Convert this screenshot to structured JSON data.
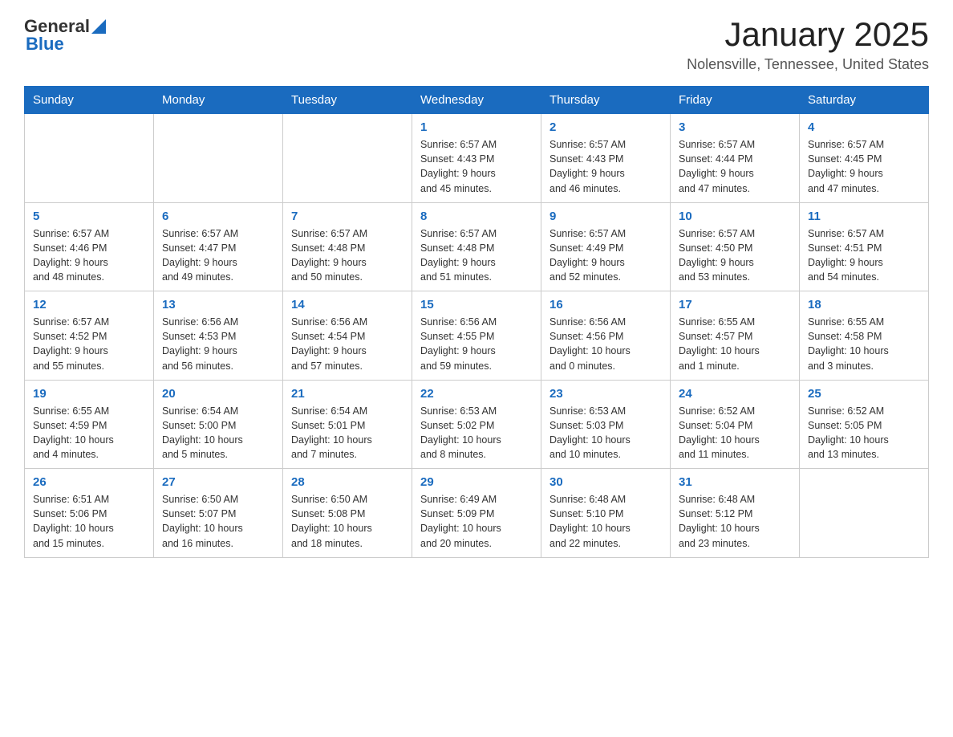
{
  "header": {
    "logo_general": "General",
    "logo_blue": "Blue",
    "month_title": "January 2025",
    "location": "Nolensville, Tennessee, United States"
  },
  "weekdays": [
    "Sunday",
    "Monday",
    "Tuesday",
    "Wednesday",
    "Thursday",
    "Friday",
    "Saturday"
  ],
  "weeks": [
    [
      {
        "day": "",
        "info": ""
      },
      {
        "day": "",
        "info": ""
      },
      {
        "day": "",
        "info": ""
      },
      {
        "day": "1",
        "info": "Sunrise: 6:57 AM\nSunset: 4:43 PM\nDaylight: 9 hours\nand 45 minutes."
      },
      {
        "day": "2",
        "info": "Sunrise: 6:57 AM\nSunset: 4:43 PM\nDaylight: 9 hours\nand 46 minutes."
      },
      {
        "day": "3",
        "info": "Sunrise: 6:57 AM\nSunset: 4:44 PM\nDaylight: 9 hours\nand 47 minutes."
      },
      {
        "day": "4",
        "info": "Sunrise: 6:57 AM\nSunset: 4:45 PM\nDaylight: 9 hours\nand 47 minutes."
      }
    ],
    [
      {
        "day": "5",
        "info": "Sunrise: 6:57 AM\nSunset: 4:46 PM\nDaylight: 9 hours\nand 48 minutes."
      },
      {
        "day": "6",
        "info": "Sunrise: 6:57 AM\nSunset: 4:47 PM\nDaylight: 9 hours\nand 49 minutes."
      },
      {
        "day": "7",
        "info": "Sunrise: 6:57 AM\nSunset: 4:48 PM\nDaylight: 9 hours\nand 50 minutes."
      },
      {
        "day": "8",
        "info": "Sunrise: 6:57 AM\nSunset: 4:48 PM\nDaylight: 9 hours\nand 51 minutes."
      },
      {
        "day": "9",
        "info": "Sunrise: 6:57 AM\nSunset: 4:49 PM\nDaylight: 9 hours\nand 52 minutes."
      },
      {
        "day": "10",
        "info": "Sunrise: 6:57 AM\nSunset: 4:50 PM\nDaylight: 9 hours\nand 53 minutes."
      },
      {
        "day": "11",
        "info": "Sunrise: 6:57 AM\nSunset: 4:51 PM\nDaylight: 9 hours\nand 54 minutes."
      }
    ],
    [
      {
        "day": "12",
        "info": "Sunrise: 6:57 AM\nSunset: 4:52 PM\nDaylight: 9 hours\nand 55 minutes."
      },
      {
        "day": "13",
        "info": "Sunrise: 6:56 AM\nSunset: 4:53 PM\nDaylight: 9 hours\nand 56 minutes."
      },
      {
        "day": "14",
        "info": "Sunrise: 6:56 AM\nSunset: 4:54 PM\nDaylight: 9 hours\nand 57 minutes."
      },
      {
        "day": "15",
        "info": "Sunrise: 6:56 AM\nSunset: 4:55 PM\nDaylight: 9 hours\nand 59 minutes."
      },
      {
        "day": "16",
        "info": "Sunrise: 6:56 AM\nSunset: 4:56 PM\nDaylight: 10 hours\nand 0 minutes."
      },
      {
        "day": "17",
        "info": "Sunrise: 6:55 AM\nSunset: 4:57 PM\nDaylight: 10 hours\nand 1 minute."
      },
      {
        "day": "18",
        "info": "Sunrise: 6:55 AM\nSunset: 4:58 PM\nDaylight: 10 hours\nand 3 minutes."
      }
    ],
    [
      {
        "day": "19",
        "info": "Sunrise: 6:55 AM\nSunset: 4:59 PM\nDaylight: 10 hours\nand 4 minutes."
      },
      {
        "day": "20",
        "info": "Sunrise: 6:54 AM\nSunset: 5:00 PM\nDaylight: 10 hours\nand 5 minutes."
      },
      {
        "day": "21",
        "info": "Sunrise: 6:54 AM\nSunset: 5:01 PM\nDaylight: 10 hours\nand 7 minutes."
      },
      {
        "day": "22",
        "info": "Sunrise: 6:53 AM\nSunset: 5:02 PM\nDaylight: 10 hours\nand 8 minutes."
      },
      {
        "day": "23",
        "info": "Sunrise: 6:53 AM\nSunset: 5:03 PM\nDaylight: 10 hours\nand 10 minutes."
      },
      {
        "day": "24",
        "info": "Sunrise: 6:52 AM\nSunset: 5:04 PM\nDaylight: 10 hours\nand 11 minutes."
      },
      {
        "day": "25",
        "info": "Sunrise: 6:52 AM\nSunset: 5:05 PM\nDaylight: 10 hours\nand 13 minutes."
      }
    ],
    [
      {
        "day": "26",
        "info": "Sunrise: 6:51 AM\nSunset: 5:06 PM\nDaylight: 10 hours\nand 15 minutes."
      },
      {
        "day": "27",
        "info": "Sunrise: 6:50 AM\nSunset: 5:07 PM\nDaylight: 10 hours\nand 16 minutes."
      },
      {
        "day": "28",
        "info": "Sunrise: 6:50 AM\nSunset: 5:08 PM\nDaylight: 10 hours\nand 18 minutes."
      },
      {
        "day": "29",
        "info": "Sunrise: 6:49 AM\nSunset: 5:09 PM\nDaylight: 10 hours\nand 20 minutes."
      },
      {
        "day": "30",
        "info": "Sunrise: 6:48 AM\nSunset: 5:10 PM\nDaylight: 10 hours\nand 22 minutes."
      },
      {
        "day": "31",
        "info": "Sunrise: 6:48 AM\nSunset: 5:12 PM\nDaylight: 10 hours\nand 23 minutes."
      },
      {
        "day": "",
        "info": ""
      }
    ]
  ]
}
